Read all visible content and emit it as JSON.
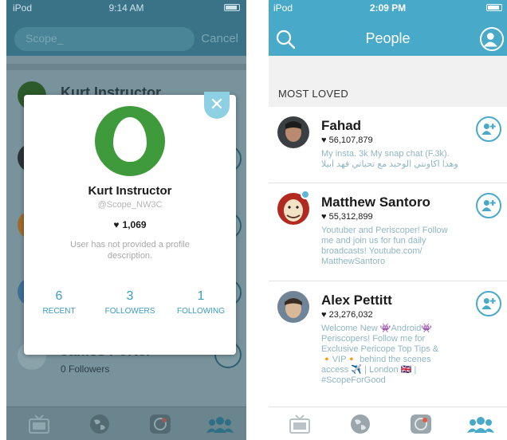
{
  "left": {
    "status": {
      "carrier": "iPod",
      "time": "9:14 AM"
    },
    "search": {
      "placeholder": "Scope_",
      "cancel_label": "Cancel"
    },
    "background_list": [
      {
        "name": "Kurt Instructor"
      },
      {
        "name": "James Porter",
        "subtitle": "0 Followers"
      }
    ],
    "modal": {
      "name": "Kurt Instructor",
      "handle": "@Scope_NW3C",
      "hearts": "1,069",
      "description": "User has not provided a profile description.",
      "stats": [
        {
          "value": "6",
          "label": "RECENT"
        },
        {
          "value": "3",
          "label": "FOLLOWERS"
        },
        {
          "value": "1",
          "label": "FOLLOWING"
        }
      ],
      "egg_color": "#3f9a3b"
    }
  },
  "right": {
    "status": {
      "carrier": "iPod",
      "time": "2:09 PM"
    },
    "title": "People",
    "section_label": "MOST LOVED",
    "accent": "#48a9c9",
    "users": [
      {
        "name": "Fahad",
        "hearts": "56,107,879",
        "bio": "My insta. 3k My snap chat (F.3k). وهذا اكاونتي الوحيد مع تحياتي فهد ابيلا",
        "verified": false
      },
      {
        "name": "Matthew Santoro",
        "hearts": "55,312,899",
        "bio": "Youtuber and Periscoper! Follow me and join us for fun daily broadcasts! Youtube.com/ MatthewSantoro",
        "verified": true
      },
      {
        "name": "Alex Pettitt",
        "hearts": "23,276,032",
        "bio": "Welcome New 👾Android👾 Periscopers! Follow me for Exclusive Pericope Top Tips & 🔸VIP🔸 behind the scenes access ✈️ | London 🇬🇧 | #ScopeForGood",
        "verified": false
      }
    ]
  },
  "tabbar_icons": [
    "tv-icon",
    "globe-icon",
    "camera-icon",
    "people-icon"
  ]
}
